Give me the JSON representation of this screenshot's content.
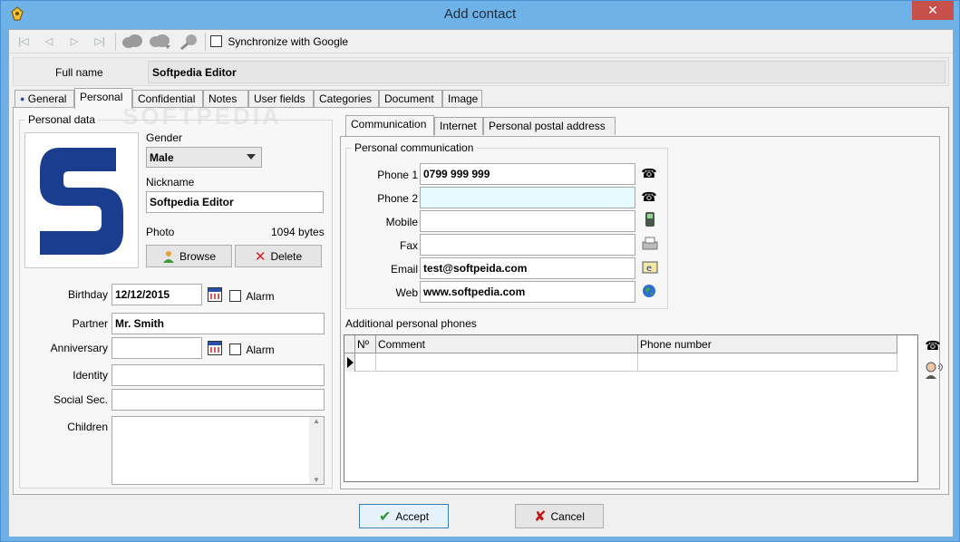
{
  "window": {
    "title": "Add contact",
    "close_symbol": "✕"
  },
  "toolbar": {
    "nav": [
      "|◁",
      "◁",
      "▷",
      "▷|"
    ],
    "sync_label": "Synchronize with Google"
  },
  "fullname": {
    "label": "Full name",
    "value": "Softpedia Editor"
  },
  "tabs": [
    "General",
    "Personal",
    "Confidential",
    "Notes",
    "User fields",
    "Categories",
    "Document",
    "Image"
  ],
  "active_tab": "Personal",
  "personal_data": {
    "legend": "Personal data",
    "gender_label": "Gender",
    "gender_value": "Male",
    "nickname_label": "Nickname",
    "nickname_value": "Softpedia Editor",
    "photo_label": "Photo",
    "photo_size": "1094 bytes",
    "browse_label": "Browse",
    "delete_label": "Delete",
    "birthday_label": "Birthday",
    "birthday_value": "12/12/2015",
    "alarm_label": "Alarm",
    "partner_label": "Partner",
    "partner_value": "Mr. Smith",
    "anniversary_label": "Anniversary",
    "anniversary_value": "",
    "identity_label": "Identity",
    "social_label": "Social Sec.",
    "children_label": "Children"
  },
  "subtabs": [
    "Communication",
    "Internet",
    "Personal postal address"
  ],
  "communication": {
    "legend": "Personal communication",
    "rows": [
      {
        "label": "Phone 1",
        "value": "0799 999 999"
      },
      {
        "label": "Phone 2",
        "value": ""
      },
      {
        "label": "Mobile",
        "value": ""
      },
      {
        "label": "Fax",
        "value": ""
      },
      {
        "label": "Email",
        "value": "test@softpeida.com"
      },
      {
        "label": "Web",
        "value": "www.softpedia.com"
      }
    ]
  },
  "additional_phones": {
    "label": "Additional personal phones",
    "columns": [
      "Nº",
      "Comment",
      "Phone number"
    ]
  },
  "buttons": {
    "accept": "Accept",
    "cancel": "Cancel"
  },
  "watermark": "SOFTPEDIA",
  "colors": {
    "titlebar": "#6fb2e8",
    "close": "#c7504a",
    "logo_blue": "#1b3d8f",
    "highlight_field": "#e6fbff"
  }
}
